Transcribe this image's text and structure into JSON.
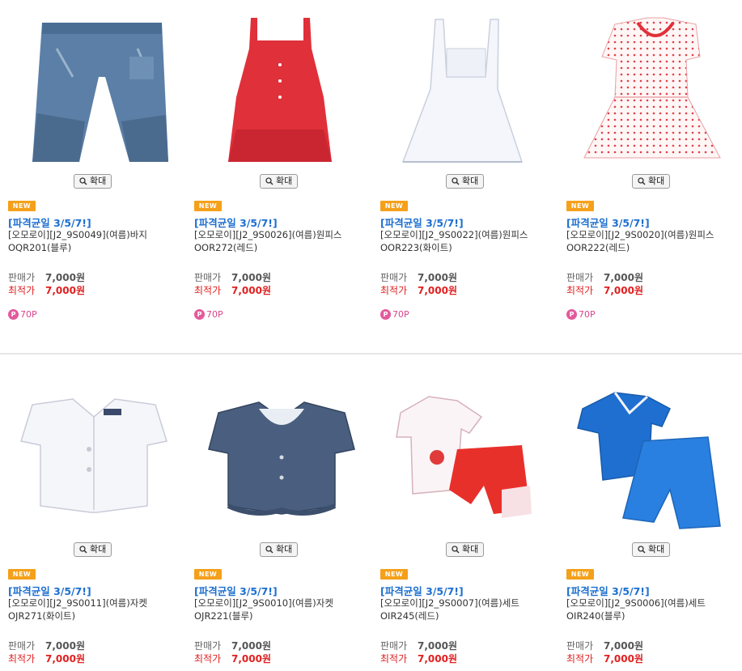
{
  "products": [
    {
      "zoom": "확대",
      "badge": "NEW",
      "promo": "[파격균일 3/5/7!]",
      "name": "[오모로이][J2_9S0049](여름)바지OQR201(블루)",
      "price_label": "판매가",
      "price": "7,000원",
      "best_label": "최적가",
      "best_price": "7,000원",
      "points": "70P",
      "image_icon": "jeans-image"
    },
    {
      "zoom": "확대",
      "badge": "NEW",
      "promo": "[파격균일 3/5/7!]",
      "name": "[오모로이][J2_9S0026](여름)원피스OOR272(레드)",
      "price_label": "판매가",
      "price": "7,000원",
      "best_label": "최적가",
      "best_price": "7,000원",
      "points": "70P",
      "image_icon": "red-dress-image"
    },
    {
      "zoom": "확대",
      "badge": "NEW",
      "promo": "[파격균일 3/5/7!]",
      "name": "[오모로이][J2_9S0022](여름)원피스OOR223(화이트)",
      "price_label": "판매가",
      "price": "7,000원",
      "best_label": "최적가",
      "best_price": "7,000원",
      "points": "70P",
      "image_icon": "white-dress-image"
    },
    {
      "zoom": "확대",
      "badge": "NEW",
      "promo": "[파격균일 3/5/7!]",
      "name": "[오모로이][J2_9S0020](여름)원피스OOR222(레드)",
      "price_label": "판매가",
      "price": "7,000원",
      "best_label": "최적가",
      "best_price": "7,000원",
      "points": "70P",
      "image_icon": "polka-dress-image"
    },
    {
      "zoom": "확대",
      "badge": "NEW",
      "promo": "[파격균일 3/5/7!]",
      "name": "[오모로이][J2_9S0011](여름)자켓OJR271(화이트)",
      "price_label": "판매가",
      "price": "7,000원",
      "best_label": "최적가",
      "best_price": "7,000원",
      "points": "",
      "image_icon": "white-jacket-image"
    },
    {
      "zoom": "확대",
      "badge": "NEW",
      "promo": "[파격균일 3/5/7!]",
      "name": "[오모로이][J2_9S0010](여름)자켓OJR221(블루)",
      "price_label": "판매가",
      "price": "7,000원",
      "best_label": "최적가",
      "best_price": "7,000원",
      "points": "",
      "image_icon": "denim-jacket-image"
    },
    {
      "zoom": "확대",
      "badge": "NEW",
      "promo": "[파격균일 3/5/7!]",
      "name": "[오모로이][J2_9S0007](여름)세트OIR245(레드)",
      "price_label": "판매가",
      "price": "7,000원",
      "best_label": "최적가",
      "best_price": "7,000원",
      "points": "",
      "image_icon": "red-set-image"
    },
    {
      "zoom": "확대",
      "badge": "NEW",
      "promo": "[파격균일 3/5/7!]",
      "name": "[오모로이][J2_9S0006](여름)세트OIR240(블루)",
      "price_label": "판매가",
      "price": "7,000원",
      "best_label": "최적가",
      "best_price": "7,000원",
      "points": "",
      "image_icon": "blue-set-image"
    }
  ],
  "colors": {
    "promo": "#1d6fd0",
    "best_price": "#e02020",
    "badge": "#f5a01a",
    "points": "#e35a9c"
  }
}
